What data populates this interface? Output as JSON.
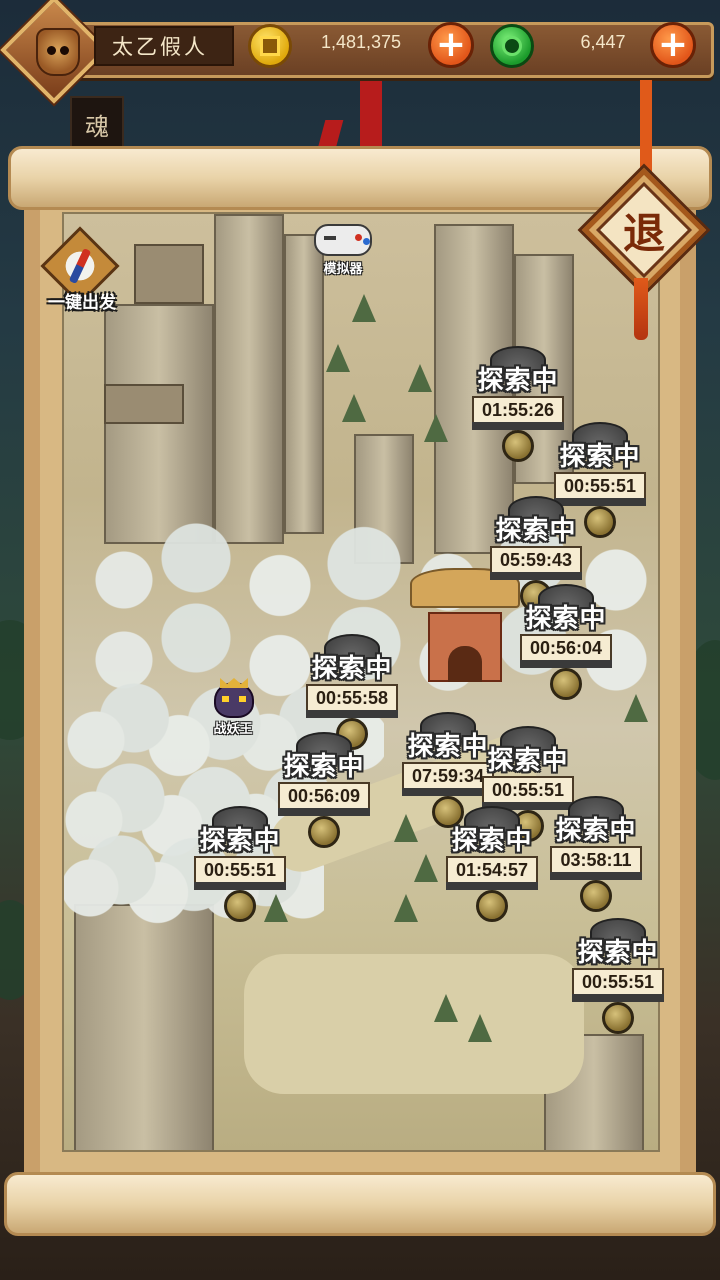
{
  "player": {
    "name": "太乙假人"
  },
  "currency": {
    "gold": "1,481,375",
    "jade": "6,447",
    "add_symbol": "+"
  },
  "background": {
    "side_tag": "魂"
  },
  "controls": {
    "exit_label": "退",
    "dispatch_all_label": "一键出发",
    "emulator_label": "模拟器",
    "demon_king_label": "战妖王"
  },
  "expeditions": [
    {
      "status": "探索中",
      "timer": "01:55:26"
    },
    {
      "status": "探索中",
      "timer": "00:55:51"
    },
    {
      "status": "探索中",
      "timer": "05:59:43"
    },
    {
      "status": "探索中",
      "timer": "00:56:04"
    },
    {
      "status": "探索中",
      "timer": "00:55:58"
    },
    {
      "status": "探索中",
      "timer": "00:56:09"
    },
    {
      "status": "探索中",
      "timer": "07:59:34"
    },
    {
      "status": "探索中",
      "timer": "00:55:51"
    },
    {
      "status": "探索中",
      "timer": "00:55:51"
    },
    {
      "status": "探索中",
      "timer": "01:54:57"
    },
    {
      "status": "探索中",
      "timer": "03:58:11"
    },
    {
      "status": "探索中",
      "timer": "00:55:51"
    }
  ],
  "colors": {
    "gold_coin": "#e0a90c",
    "jade_coin": "#1c9c2c",
    "plus_button": "#e2561a",
    "exit_tassel": "#e05a1a"
  }
}
